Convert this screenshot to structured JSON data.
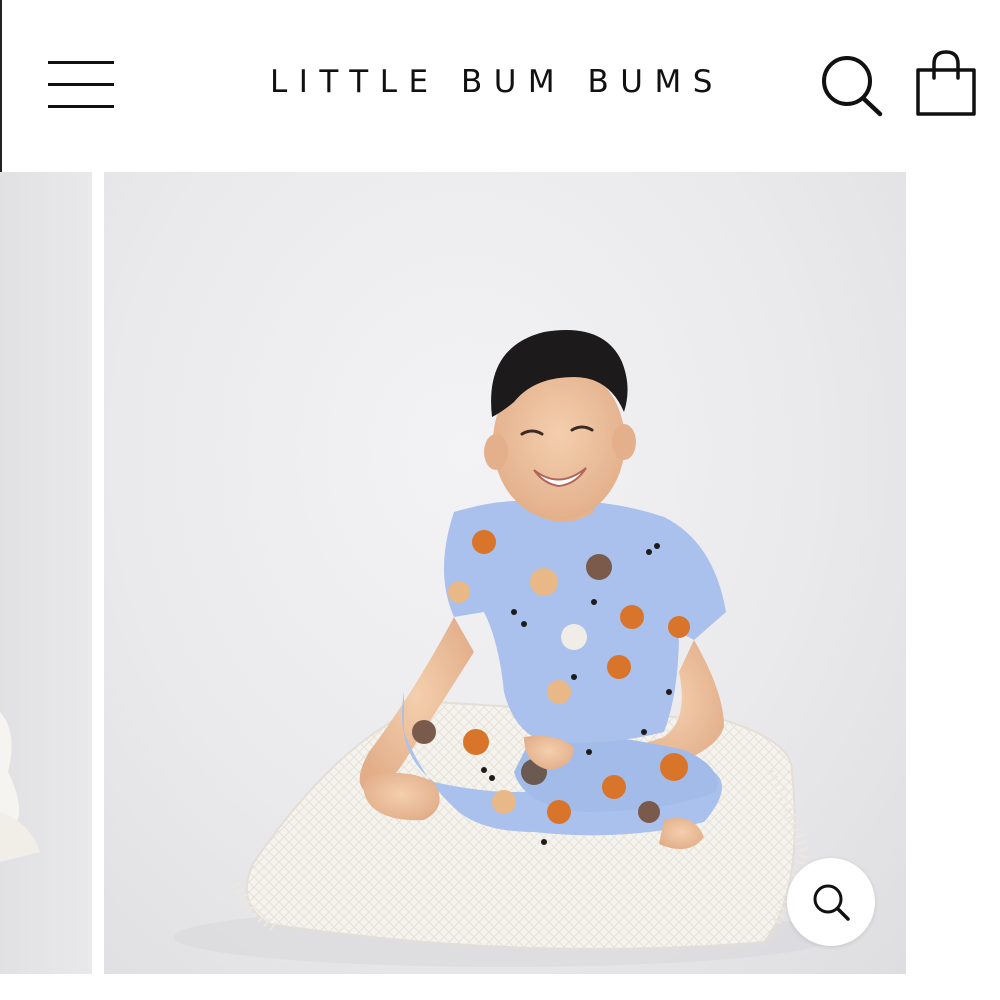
{
  "header": {
    "brand": "LITTLE BUM BUMS",
    "menu_icon": "hamburger-menu-icon",
    "search_icon": "search-icon",
    "cart_icon": "shopping-bag-icon"
  },
  "gallery": {
    "main_image": "product-photo-kids-dog-print-pajamas",
    "prev_image": "product-photo-previous",
    "zoom_icon": "zoom-search-icon"
  },
  "colors": {
    "text": "#111111",
    "background": "#ffffff",
    "pajama_blue": "#a9c1ec",
    "dog_orange": "#d9752a"
  }
}
